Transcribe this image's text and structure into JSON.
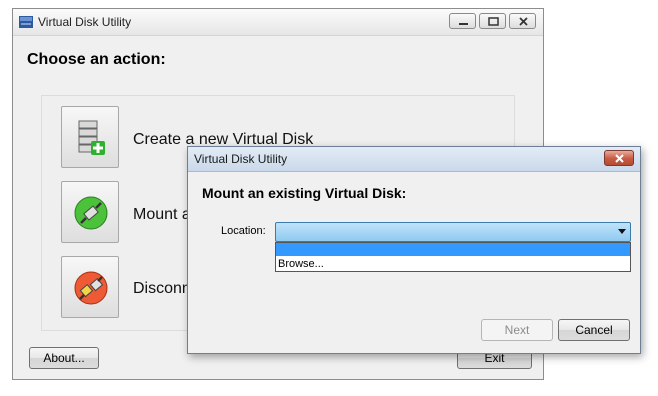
{
  "main_window": {
    "title": "Virtual Disk Utility",
    "heading": "Choose an action:",
    "actions": [
      {
        "label": "Create a new Virtual Disk",
        "icon": "create-disk-icon"
      },
      {
        "label": "Mount a",
        "icon": "mount-plug-icon"
      },
      {
        "label": "Disconn",
        "icon": "disconnect-plug-icon"
      }
    ],
    "about_label": "About...",
    "exit_label": "Exit"
  },
  "dialog": {
    "title": "Virtual Disk Utility",
    "heading": "Mount an existing Virtual Disk:",
    "location_label": "Location:",
    "location_value": "",
    "dropdown_options": [
      "",
      "Browse..."
    ],
    "next_label": "Next",
    "cancel_label": "Cancel"
  },
  "colors": {
    "selection_blue": "#3399ff",
    "dialog_title_bg": "#c9d8ea",
    "close_red": "#c75a43"
  }
}
